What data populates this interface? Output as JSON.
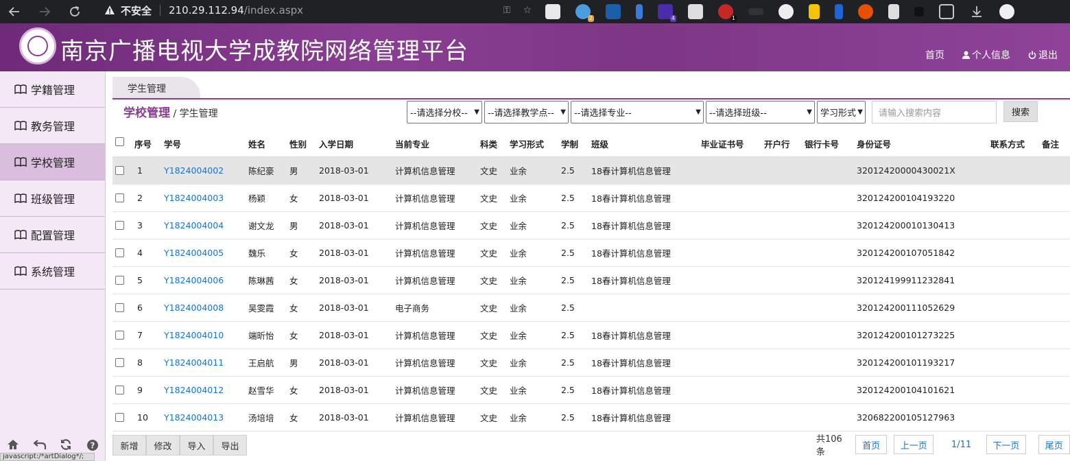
{
  "browser": {
    "insecure_label": "不安全",
    "url_host": "210.29.112.94",
    "url_path": "/index.aspx",
    "extension_badges": [
      "2",
      "4",
      "1"
    ],
    "status_url": "javascript:/*artDialog*/;"
  },
  "header": {
    "title": "南京广播电视大学成教院网络管理平台",
    "links": {
      "home": "首页",
      "profile": "个人信息",
      "logout": "退出"
    }
  },
  "sidebar": {
    "items": [
      {
        "label": "学籍管理"
      },
      {
        "label": "教务管理"
      },
      {
        "label": "学校管理"
      },
      {
        "label": "班级管理"
      },
      {
        "label": "配置管理"
      },
      {
        "label": "系统管理"
      }
    ]
  },
  "tab": {
    "label": "学生管理"
  },
  "breadcrumb": {
    "section": "学校管理",
    "sep": " / ",
    "page": "学生管理"
  },
  "filters": {
    "branch": "--请选择分校--",
    "teaching_point": "--请选择教学点--",
    "major": "--请选择专业--",
    "class": "--请选择班级--",
    "study_form": "学习形式",
    "search_placeholder": "请输入搜索内容",
    "search_button": "搜索"
  },
  "table": {
    "columns": [
      "序号",
      "学号",
      "姓名",
      "性别",
      "入学日期",
      "当前专业",
      "科类",
      "学习形式",
      "学制",
      "班级",
      "毕业证书号",
      "开户行",
      "银行卡号",
      "身份证号",
      "联系方式",
      "备注"
    ],
    "rows": [
      {
        "no": "1",
        "id": "Y1824004002",
        "name": "陈纪豪",
        "gender": "男",
        "date": "2018-03-01",
        "major": "计算机信息管理",
        "category": "文史",
        "form": "业余",
        "years": "2.5",
        "class": "18春计算机信息管理",
        "idcard": "32012420000430021X"
      },
      {
        "no": "2",
        "id": "Y1824004003",
        "name": "杨颖",
        "gender": "女",
        "date": "2018-03-01",
        "major": "计算机信息管理",
        "category": "文史",
        "form": "业余",
        "years": "2.5",
        "class": "18春计算机信息管理",
        "idcard": "320124200104193220"
      },
      {
        "no": "3",
        "id": "Y1824004004",
        "name": "谢文龙",
        "gender": "男",
        "date": "2018-03-01",
        "major": "计算机信息管理",
        "category": "文史",
        "form": "业余",
        "years": "2.5",
        "class": "18春计算机信息管理",
        "idcard": "320124200010130413"
      },
      {
        "no": "4",
        "id": "Y1824004005",
        "name": "魏乐",
        "gender": "女",
        "date": "2018-03-01",
        "major": "计算机信息管理",
        "category": "文史",
        "form": "业余",
        "years": "2.5",
        "class": "18春计算机信息管理",
        "idcard": "320124200107051842"
      },
      {
        "no": "5",
        "id": "Y1824004006",
        "name": "陈琳茜",
        "gender": "女",
        "date": "2018-03-01",
        "major": "计算机信息管理",
        "category": "文史",
        "form": "业余",
        "years": "2.5",
        "class": "18春计算机信息管理",
        "idcard": "320124199911232841"
      },
      {
        "no": "6",
        "id": "Y1824004008",
        "name": "吴雯霞",
        "gender": "女",
        "date": "2018-03-01",
        "major": "电子商务",
        "category": "文史",
        "form": "业余",
        "years": "2.5",
        "class": "",
        "idcard": "320124200111052629"
      },
      {
        "no": "7",
        "id": "Y1824004010",
        "name": "端昕怡",
        "gender": "女",
        "date": "2018-03-01",
        "major": "计算机信息管理",
        "category": "文史",
        "form": "业余",
        "years": "2.5",
        "class": "18春计算机信息管理",
        "idcard": "320124200101273225"
      },
      {
        "no": "8",
        "id": "Y1824004011",
        "name": "王启航",
        "gender": "男",
        "date": "2018-03-01",
        "major": "计算机信息管理",
        "category": "文史",
        "form": "业余",
        "years": "2.5",
        "class": "18春计算机信息管理",
        "idcard": "320124200101193217"
      },
      {
        "no": "9",
        "id": "Y1824004012",
        "name": "赵雪华",
        "gender": "女",
        "date": "2018-03-01",
        "major": "计算机信息管理",
        "category": "文史",
        "form": "业余",
        "years": "2.5",
        "class": "18春计算机信息管理",
        "idcard": "320124200104101621"
      },
      {
        "no": "10",
        "id": "Y1824004013",
        "name": "汤培培",
        "gender": "女",
        "date": "2018-03-01",
        "major": "计算机信息管理",
        "category": "文史",
        "form": "业余",
        "years": "2.5",
        "class": "18春计算机信息管理",
        "idcard": "320682200105127963"
      }
    ]
  },
  "actions": {
    "add": "新增",
    "edit": "修改",
    "import": "导入",
    "export": "导出"
  },
  "pager": {
    "total": "共106条",
    "first": "首页",
    "prev": "上一页",
    "current": "1/11",
    "next": "下一页",
    "last": "尾页"
  },
  "colors": {
    "brand": "#8a3e93",
    "link": "#1a73c6",
    "sidebar_bg": "#f5e8f6",
    "sidebar_active": "#d9bedd"
  }
}
